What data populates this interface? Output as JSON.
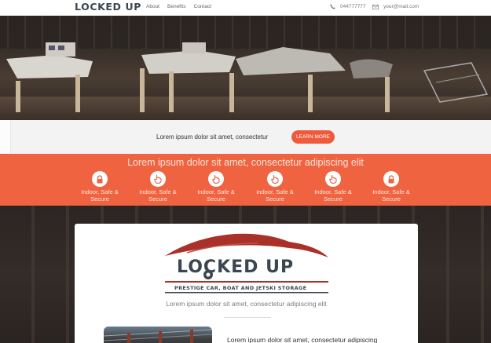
{
  "nav": {
    "logo": "LOCKED UP",
    "links": [
      "About",
      "Benefits",
      "Contact"
    ],
    "phone": "044777777",
    "email": "your@mail.com"
  },
  "cta": {
    "text": "Lorem ipsum dolor sit amet, consectetur",
    "button": "LEARN MORE"
  },
  "band": {
    "title": "Lorem ipsum dolor sit amet, consectetur adipiscing elit",
    "features": [
      {
        "line1": "Indoor, Safe &",
        "line2": "Secure",
        "icon": "lock-icon"
      },
      {
        "line1": "Indoor, Safe &",
        "line2": "Secure",
        "icon": "hand-pointer-icon"
      },
      {
        "line1": "Indoor, Safe &",
        "line2": "Secure",
        "icon": "hand-pointer-icon"
      },
      {
        "line1": "Indoor, Safe &",
        "line2": "Secure",
        "icon": "hand-pointer-icon"
      },
      {
        "line1": "Indoor, Safe &",
        "line2": "Secure",
        "icon": "hand-pointer-icon"
      },
      {
        "line1": "Indoor, Safe &",
        "line2": "Secure",
        "icon": "lock-icon"
      }
    ]
  },
  "card": {
    "logo_title": "LOCKED UP",
    "logo_subtitle": "PRESTIGE CAR, BOAT AND JETSKI STORAGE",
    "tagline": "Lorem ipsum dolor sit amet, consectetur adipiscing elit",
    "body_text": "Lorem ipsum dolor sit amet, consectetur adipiscing"
  },
  "colors": {
    "accent": "#ef6340",
    "button": "#ee5b3c",
    "logo_dark": "#3c4650",
    "logo_red": "#a9312a"
  }
}
